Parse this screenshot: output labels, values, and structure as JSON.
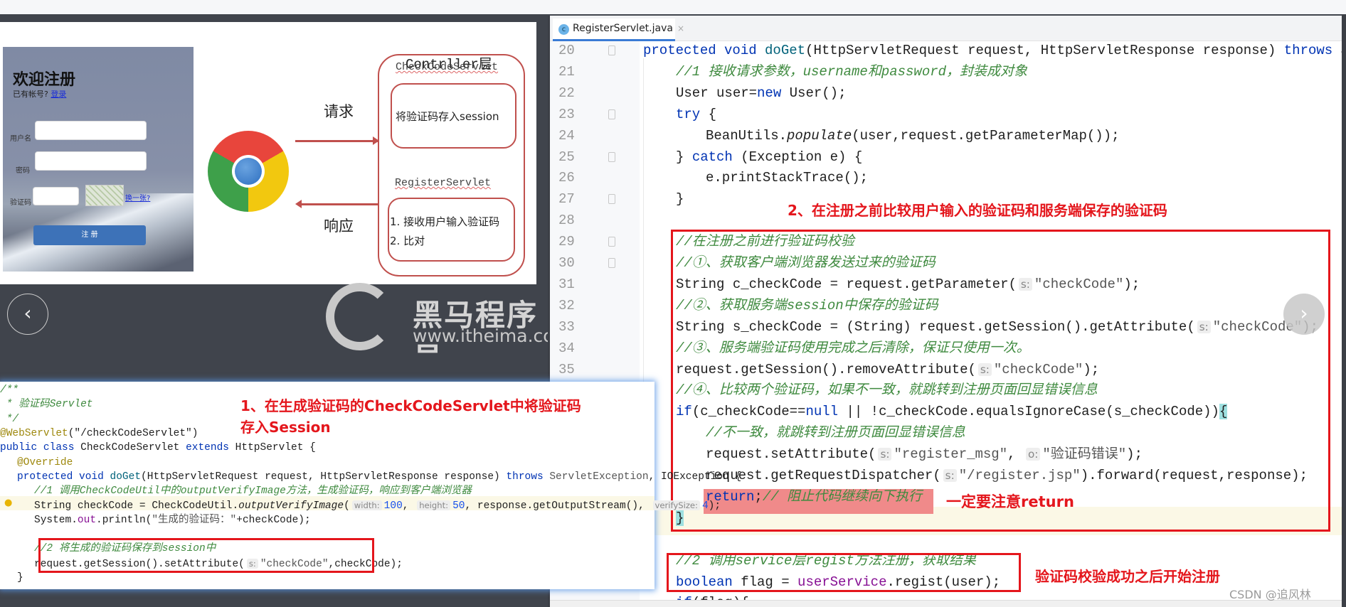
{
  "slide": {
    "layer_title": "Contrller层",
    "login": {
      "title": "欢迎注册",
      "has_account": "已有帐号?",
      "login_link": "登录",
      "username_label": "用户名",
      "password_label": "密码",
      "captcha_label": "验证码",
      "change_link": "换一张?",
      "register_button": "注 册"
    },
    "request_label": "请求",
    "response_label": "响应",
    "servlet1": "CheckCodeServlet",
    "servlet1_box": "将验证码存入session",
    "servlet2": "RegisterServlet",
    "servlet2_items": [
      "1. 接收用户输入验证码",
      "2. 比对"
    ],
    "logo_cn": "黑马程序员",
    "logo_url": "www.itheima.com"
  },
  "ide": {
    "tab": "RegisterServlet.java",
    "line_numbers": [
      "20",
      "21",
      "22",
      "23",
      "24",
      "25",
      "26",
      "27",
      "28",
      "29",
      "30",
      "31",
      "32",
      "33",
      "34",
      "35"
    ],
    "lines": [
      {
        "i": 0,
        "s": [
          [
            "kw",
            "protected void "
          ],
          [
            "mth",
            "doGet"
          ],
          [
            "",
            "(HttpServletRequest request, HttpServletResponse response) "
          ],
          [
            "kw",
            "throws"
          ],
          [
            "",
            " Se"
          ]
        ]
      },
      {
        "i": 1,
        "s": [
          [
            "cm",
            "//1 接收请求参数，username和password，封装成对象"
          ]
        ]
      },
      {
        "i": 1,
        "s": [
          [
            "",
            "User user="
          ],
          [
            "kw",
            "new"
          ],
          [
            "",
            " User();"
          ]
        ]
      },
      {
        "i": 1,
        "s": [
          [
            "kw",
            "try"
          ],
          [
            "",
            " {"
          ]
        ]
      },
      {
        "i": 2,
        "s": [
          [
            "",
            "BeanUtils."
          ],
          [
            "fn",
            "populate"
          ],
          [
            "",
            "(user,request.getParameterMap());"
          ]
        ]
      },
      {
        "i": 1,
        "s": [
          [
            "",
            "} "
          ],
          [
            "kw",
            "catch"
          ],
          [
            "",
            " (Exception e) {"
          ]
        ]
      },
      {
        "i": 2,
        "s": [
          [
            "",
            "e.printStackTrace();"
          ]
        ]
      },
      {
        "i": 1,
        "s": [
          [
            "",
            "}"
          ]
        ]
      },
      {
        "i": 1,
        "s": []
      },
      {
        "i": 1,
        "s": [
          [
            "cm",
            "//在注册之前进行验证码校验"
          ]
        ]
      },
      {
        "i": 1,
        "s": [
          [
            "cm",
            "//①、获取客户端浏览器发送过来的验证码"
          ]
        ]
      },
      {
        "i": 1,
        "s": [
          [
            "",
            "String c_checkCode = request.getParameter("
          ],
          [
            "hint",
            "s:"
          ],
          [
            "str",
            "\"checkCode\""
          ],
          [
            "",
            ");"
          ]
        ]
      },
      {
        "i": 1,
        "s": [
          [
            "cm",
            "//②、获取服务端session中保存的验证码"
          ]
        ]
      },
      {
        "i": 1,
        "s": [
          [
            "",
            "String s_checkCode = (String) request.getSession().getAttribute("
          ],
          [
            "hint",
            "s:"
          ],
          [
            "str",
            "\"checkCode\""
          ],
          [
            "",
            ");"
          ]
        ]
      },
      {
        "i": 1,
        "s": [
          [
            "cm",
            "//③、服务端验证码使用完成之后清除，保证只使用一次。"
          ]
        ]
      },
      {
        "i": 1,
        "s": [
          [
            "",
            "request.getSession().removeAttribute("
          ],
          [
            "hint",
            "s:"
          ],
          [
            "str",
            "\"checkCode\""
          ],
          [
            "",
            ");"
          ]
        ]
      },
      {
        "i": 1,
        "s": [
          [
            "cm",
            "//④、比较两个验证码，如果不一致，就跳转到注册页面回显错误信息"
          ]
        ]
      },
      {
        "i": 1,
        "s": [
          [
            "kw",
            "if"
          ],
          [
            "",
            "(c_checkCode=="
          ],
          [
            "kw",
            "null"
          ],
          [
            "",
            " || !c_checkCode.equalsIgnoreCase(s_checkCode))"
          ],
          [
            "hl",
            "{"
          ]
        ]
      },
      {
        "i": 2,
        "s": [
          [
            "cm",
            "//不一致，就跳转到注册页面回显错误信息"
          ]
        ]
      },
      {
        "i": 2,
        "s": [
          [
            "",
            "request.setAttribute("
          ],
          [
            "hint",
            "s:"
          ],
          [
            "str",
            "\"register_msg\""
          ],
          [
            "",
            ", "
          ],
          [
            "hint",
            "o:"
          ],
          [
            "str",
            "\"验证码错误\""
          ],
          [
            "",
            ");"
          ]
        ]
      },
      {
        "i": 2,
        "s": [
          [
            "",
            "request.getRequestDispatcher("
          ],
          [
            "hint",
            "s:"
          ],
          [
            "str",
            "\"/register.jsp\""
          ],
          [
            "",
            ").forward(request,response);"
          ]
        ]
      },
      {
        "i": 2,
        "s": [
          [
            "kw",
            "return"
          ],
          [
            "",
            ";"
          ],
          [
            "cm",
            "// 阻止代码继续向下执行"
          ]
        ]
      },
      {
        "i": 1,
        "s": [
          [
            "hl",
            "}"
          ]
        ]
      },
      {
        "i": 1,
        "s": []
      },
      {
        "i": 1,
        "s": [
          [
            "cm",
            "//2 调用service层regist方法注册，获取结果"
          ]
        ]
      },
      {
        "i": 1,
        "s": [
          [
            "kw",
            "boolean"
          ],
          [
            "",
            " flag = "
          ],
          [
            "fld",
            "userService"
          ],
          [
            "",
            ".regist(user);"
          ]
        ]
      },
      {
        "i": 1,
        "s": [
          [
            "kw",
            "if"
          ],
          [
            "",
            "(flag){"
          ]
        ]
      }
    ]
  },
  "snippet": {
    "lines": [
      {
        "i": 0,
        "s": [
          [
            "cm",
            "/**"
          ]
        ]
      },
      {
        "i": 0,
        "s": [
          [
            "cm",
            " * 验证码Servlet"
          ]
        ]
      },
      {
        "i": 0,
        "s": [
          [
            "cm",
            " */"
          ]
        ]
      },
      {
        "i": 0,
        "s": [
          [
            "ann",
            "@WebServlet"
          ],
          [
            "",
            "(\"/checkCodeServlet\")"
          ]
        ]
      },
      {
        "i": 0,
        "s": [
          [
            "kw",
            "public class "
          ],
          [
            "",
            "CheckCodeServlet "
          ],
          [
            "kw",
            "extends"
          ],
          [
            "",
            " HttpServlet {"
          ]
        ]
      },
      {
        "i": 1,
        "s": [
          [
            "ann",
            "@Override"
          ]
        ]
      },
      {
        "i": 1,
        "s": [
          [
            "kw",
            "protected void "
          ],
          [
            "mth",
            "doGet"
          ],
          [
            "",
            "(HttpServletRequest request, HttpServletResponse response) "
          ],
          [
            "kw",
            "throws "
          ],
          [
            "str",
            "ServletException"
          ],
          [
            "",
            ", IOException {"
          ]
        ]
      },
      {
        "i": 2,
        "s": [
          [
            "cm",
            "//1 调用CheckCodeUtil中的outputVerifyImage方法，生成验证码，响应到客户端浏览器"
          ]
        ]
      },
      {
        "i": 2,
        "s": [
          [
            "",
            "String checkCode = CheckCodeUtil."
          ],
          [
            "fn",
            "outputVerifyImage"
          ],
          [
            "",
            "("
          ],
          [
            "hint",
            "width:"
          ],
          [
            "num",
            "100"
          ],
          [
            "",
            ", "
          ],
          [
            "hint",
            "height:"
          ],
          [
            "num",
            "50"
          ],
          [
            "",
            ", response.getOutputStream(), "
          ],
          [
            "hint",
            "verifySize:"
          ],
          [
            "num",
            "4"
          ],
          [
            "",
            ");"
          ]
        ]
      },
      {
        "i": 2,
        "s": [
          [
            "",
            "System."
          ],
          [
            "fld",
            "out"
          ],
          [
            "",
            ".println("
          ],
          [
            "str",
            "\"生成的验证码：\""
          ],
          [
            "",
            "+checkCode);"
          ]
        ]
      },
      {
        "i": 2,
        "s": []
      },
      {
        "i": 2,
        "s": [
          [
            "cm",
            "//2 将生成的验证码保存到session中"
          ]
        ]
      },
      {
        "i": 2,
        "s": [
          [
            "",
            "request.getSession().setAttribute("
          ],
          [
            "hint",
            "s:"
          ],
          [
            "str",
            "\"checkCode\""
          ],
          [
            "",
            ",checkCode);"
          ]
        ]
      },
      {
        "i": 1,
        "s": [
          [
            "",
            "}"
          ]
        ]
      }
    ]
  },
  "notes": {
    "note1_line1": "1、在生成验证码的CheckCodeServlet中将验证码",
    "note1_line2": "存入Session",
    "note2": "2、在注册之前比较用户输入的验证码和服务端保存的验证码",
    "note3": "一定要注意return",
    "note4": "验证码校验成功之后开始注册"
  },
  "nav": {
    "prev": "‹",
    "next": "›"
  },
  "watermark": "CSDN @追风林",
  "colors": {
    "annotation_red": "#e4161c",
    "diagram_red": "#c0504d",
    "keyword_blue": "#0033b3",
    "comment_green": "#3f8a3f"
  }
}
